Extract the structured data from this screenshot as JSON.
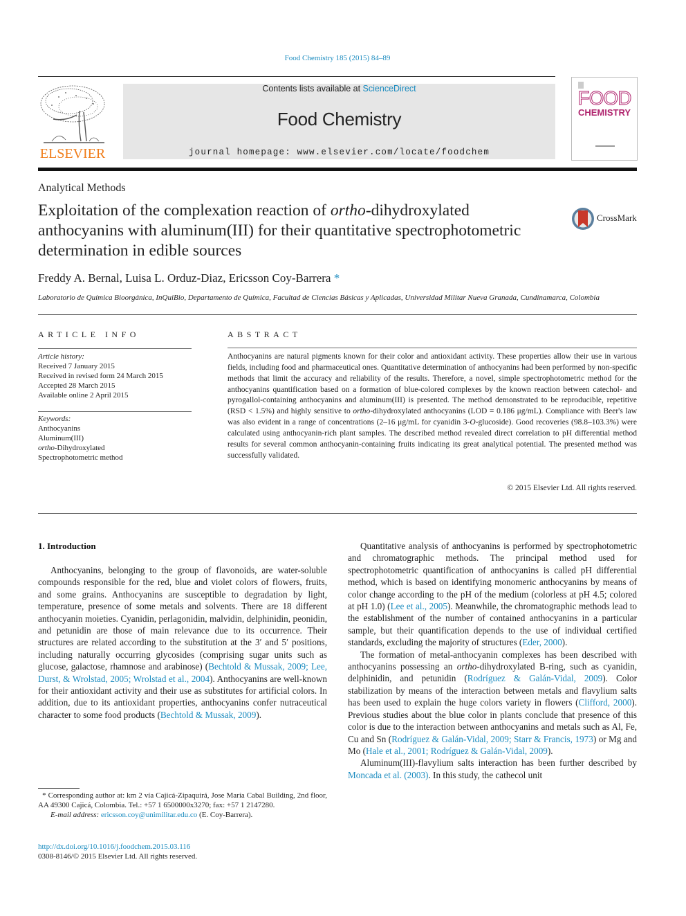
{
  "header": {
    "journal_ref": "Food Chemistry 185 (2015) 84–89",
    "contents_prefix": "Contents lists available at ",
    "contents_link": "ScienceDirect",
    "journal_name": "Food Chemistry",
    "homepage": "journal homepage: www.elsevier.com/locate/foodchem",
    "publisher_logo_text": "ELSEVIER",
    "cover_title_top": "FOOD",
    "cover_title_bottom": "CHEMISTRY",
    "colors": {
      "link": "#1a8bbf",
      "elsevier_orange": "#f07d1a",
      "cover_magenta": "#b0246e",
      "masthead_gray": "#e6e6e6"
    }
  },
  "article": {
    "section": "Analytical Methods",
    "title_part1": "Exploitation of the complexation reaction of ",
    "title_italic": "ortho",
    "title_part2": "-dihydroxylated anthocyanins with aluminum(III) for their quantitative spectrophotometric determination in edible sources",
    "crossmark_label": "CrossMark",
    "authors": "Freddy A. Bernal, Luisa L. Orduz-Diaz, Ericsson Coy-Barrera",
    "author_mark": "*",
    "affiliation": "Laboratorio de Química Bioorgánica, InQuiBio, Departamento de Química, Facultad de Ciencias Básicas y Aplicadas, Universidad Militar Nueva Granada, Cundinamarca, Colombia"
  },
  "article_info": {
    "heading": "ARTICLE INFO",
    "history_label": "Article history:",
    "history": [
      "Received 7 January 2015",
      "Received in revised form 24 March 2015",
      "Accepted 28 March 2015",
      "Available online 2 April 2015"
    ],
    "keywords_label": "Keywords:",
    "keywords": [
      "Anthocyanins",
      "Aluminum(III)",
      "Spectrophotometric method"
    ],
    "keyword_ortho_italic": "ortho",
    "keyword_ortho_rest": "-Dihydroxylated"
  },
  "abstract": {
    "heading": "ABSTRACT",
    "text_a": "Anthocyanins are natural pigments known for their color and antioxidant activity. These properties allow their use in various fields, including food and pharmaceutical ones. Quantitative determination of anthocyanins had been performed by non-specific methods that limit the accuracy and reliability of the results. Therefore, a novel, simple spectrophotometric method for the anthocyanins quantification based on a formation of blue-colored complexes by the known reaction between catechol- and pyrogallol-containing anthocyanins and aluminum(III) is presented. The method demonstrated to be reproducible, repetitive (RSD < 1.5%) and highly sensitive to ",
    "text_italic": "ortho",
    "text_b": "-dihydroxylated anthocyanins (LOD = 0.186 μg/mL). Compliance with Beer's law was also evident in a range of concentrations (2–16 μg/mL for cyanidin 3-",
    "text_italic2": "O",
    "text_c": "-glucoside). Good recoveries (98.8–103.3%) were calculated using anthocyanin-rich plant samples. The described method revealed direct correlation to pH differential method results for several common anthocyanin-containing fruits indicating its great analytical potential. The presented method was successfully validated.",
    "copyright": "© 2015 Elsevier Ltd. All rights reserved."
  },
  "intro": {
    "heading": "1. Introduction",
    "p1_a": "Anthocyanins, belonging to the group of flavonoids, are water-soluble compounds responsible for the red, blue and violet colors of flowers, fruits, and some grains. Anthocyanins are susceptible to degradation by light, temperature, presence of some metals and solvents. There are 18 different anthocyanin moieties. Cyanidin, perlagonidin, malvidin, delphinidin, peonidin, and petunidin are those of main relevance due to its occurrence. Their structures are related according to the substitution at the 3′ and 5′ positions, including naturally occurring glycosides (comprising sugar units such as glucose, galactose, rhamnose and arabinose) (",
    "p1_cite1": "Bechtold & Mussak, 2009; Lee, Durst, & Wrolstad, 2005; Wrolstad et al., 2004",
    "p1_b": "). Anthocyanins are well-known for their antioxidant activity and their use as substitutes for artificial colors. In addition, due to its antioxidant properties, anthocyanins confer nutraceutical character to some food products (",
    "p1_cite2": "Bechtold & Mussak, 2009",
    "p1_c": ").",
    "p2_a": "Quantitative analysis of anthocyanins is performed by spectrophotometric and chromatographic methods. The principal method used for spectrophotometric quantification of anthocyanins is called pH differential method, which is based on identifying monomeric anthocyanins by means of color change according to the pH of the medium (colorless at pH 4.5; colored at pH 1.0) (",
    "p2_cite1": "Lee et al., 2005",
    "p2_b": "). Meanwhile, the chromatographic methods lead to the establishment of the number of contained anthocyanins in a particular sample, but their quantification depends to the use of individual certified standards, excluding the majority of structures (",
    "p2_cite2": "Eder, 2000",
    "p2_c": ").",
    "p3_a": "The formation of metal-anthocyanin complexes has been described with anthocyanins possessing an ",
    "p3_italic": "ortho",
    "p3_b": "-dihydroxylated B-ring, such as cyanidin, delphinidin, and petunidin (",
    "p3_cite1": "Rodríguez & Galán-Vidal, 2009",
    "p3_c": "). Color stabilization by means of the interaction between metals and flavylium salts has been used to explain the huge colors variety in flowers (",
    "p3_cite2": "Clifford, 2000",
    "p3_d": "). Previous studies about the blue color in plants conclude that presence of this color is due to the interaction between anthocyanins and metals such as Al, Fe, Cu and Sn (",
    "p3_cite3": "Rodríguez & Galán-Vidal, 2009; Starr & Francis, 1973",
    "p3_e": ") or Mg and Mo (",
    "p3_cite4": "Hale et al., 2001; Rodríguez & Galán-Vidal, 2009",
    "p3_f": ").",
    "p4_a": "Aluminum(III)-flavylium salts interaction has been further described by ",
    "p4_cite1": "Moncada et al. (2003)",
    "p4_b": ". In this study, the cathecol unit"
  },
  "footnote": {
    "star": "*",
    "corresponding": " Corresponding author at: km 2 vía Cajicá-Zipaquirá, Jose María Cabal Building, 2nd floor, AA 49300 Cajicá, Colombia. Tel.: +57 1 6500000x3270; fax: +57 1 2147280.",
    "email_label": "E-mail address: ",
    "email": "ericsson.coy@unimilitar.edu.co",
    "email_owner": " (E. Coy-Barrera).",
    "doi": "http://dx.doi.org/10.1016/j.foodchem.2015.03.116",
    "issn_line": "0308-8146/© 2015 Elsevier Ltd. All rights reserved."
  }
}
